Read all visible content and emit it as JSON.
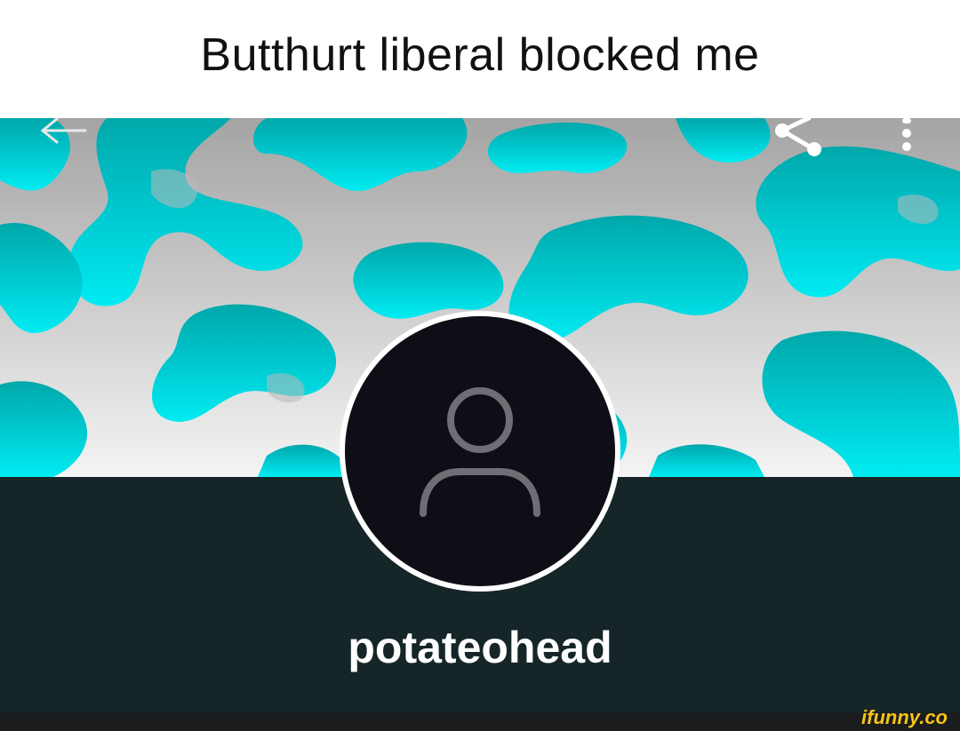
{
  "caption": {
    "text": "Butthurt liberal blocked me"
  },
  "toolbar": {
    "back_icon": "arrow-left-icon",
    "share_icon": "share-icon",
    "more_icon": "more-vertical-icon"
  },
  "banner": {
    "pattern": "camouflage",
    "colors": {
      "cyan": "#00dce4",
      "teal": "#00c5cc",
      "grey_top": "#a9a9a9",
      "grey_bottom": "#f2f2f2"
    }
  },
  "profile": {
    "username": "potateohead",
    "avatar_icon": "default-user-icon",
    "background": "#162628"
  },
  "watermark": {
    "text": "ifunny.co",
    "color": "#f5c518"
  }
}
